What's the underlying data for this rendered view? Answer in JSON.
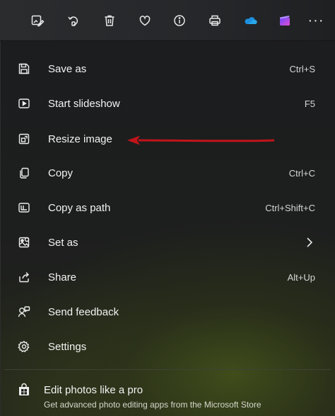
{
  "toolbar": {
    "buttons": [
      {
        "name": "edit-image-icon"
      },
      {
        "name": "rotate-icon"
      },
      {
        "name": "delete-icon"
      },
      {
        "name": "favorite-icon"
      },
      {
        "name": "info-icon"
      },
      {
        "name": "print-icon"
      },
      {
        "name": "onedrive-icon"
      },
      {
        "name": "clipchamp-icon"
      }
    ],
    "more_label": "···"
  },
  "menu": {
    "items": [
      {
        "label": "Save as",
        "shortcut": "Ctrl+S",
        "icon": "save-icon"
      },
      {
        "label": "Start slideshow",
        "shortcut": "F5",
        "icon": "slideshow-icon"
      },
      {
        "label": "Resize image",
        "shortcut": "",
        "icon": "resize-icon"
      },
      {
        "label": "Copy",
        "shortcut": "Ctrl+C",
        "icon": "copy-icon"
      },
      {
        "label": "Copy as path",
        "shortcut": "Ctrl+Shift+C",
        "icon": "copy-path-icon"
      },
      {
        "label": "Set as",
        "shortcut": "",
        "icon": "set-as-icon"
      },
      {
        "label": "Share",
        "shortcut": "Alt+Up",
        "icon": "share-icon"
      },
      {
        "label": "Send feedback",
        "shortcut": "",
        "icon": "feedback-icon"
      },
      {
        "label": "Settings",
        "shortcut": "",
        "icon": "settings-icon"
      }
    ],
    "promo": {
      "title": "Edit photos like a pro",
      "subtitle": "Get advanced photo editing apps from the Microsoft Store",
      "icon": "store-icon"
    }
  },
  "colors": {
    "annotation_arrow": "#c0141a",
    "onedrive": "#1d8fe1",
    "clipchamp": "#9b5de5"
  }
}
